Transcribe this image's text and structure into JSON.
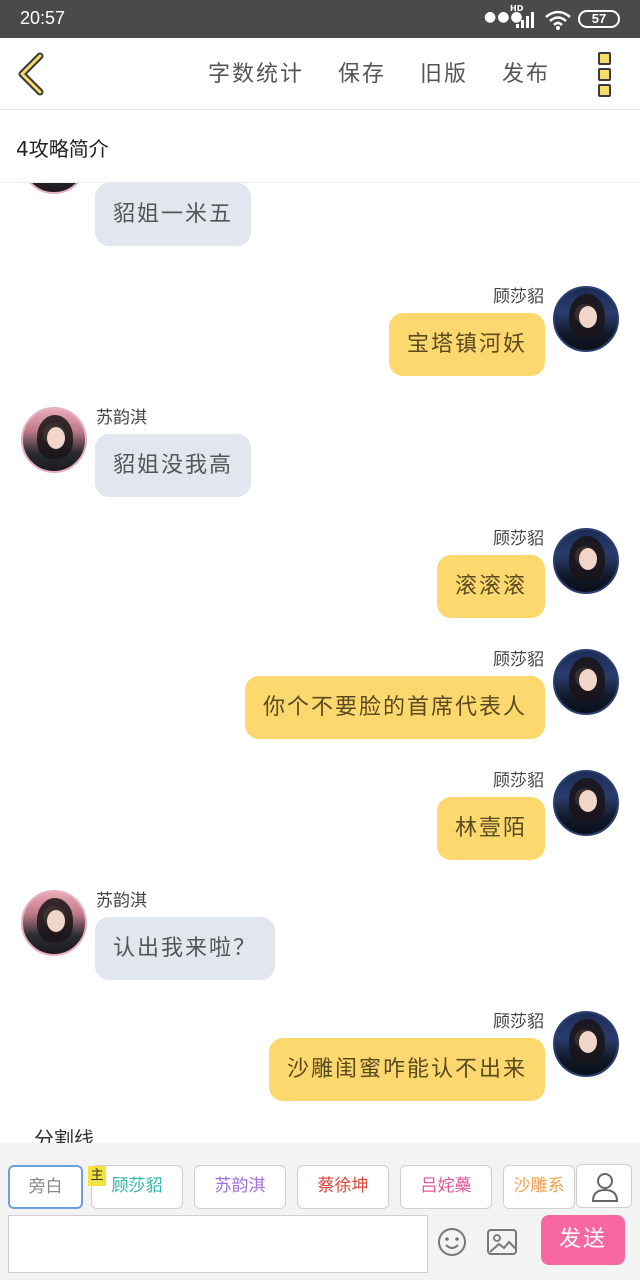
{
  "status_bar": {
    "time": "20:57",
    "battery": "57",
    "network": "HD"
  },
  "toolbar": {
    "word_count": "字数统计",
    "save": "保存",
    "old_version": "旧版",
    "publish": "发布"
  },
  "doc": {
    "title": "4攻略简介"
  },
  "messages": [
    {
      "side": "left",
      "name": "",
      "text": "貂姐一米五"
    },
    {
      "side": "right",
      "name": "顾莎貂",
      "text": "宝塔镇河妖"
    },
    {
      "side": "left",
      "name": "苏韵淇",
      "text": "貂姐没我高"
    },
    {
      "side": "right",
      "name": "顾莎貂",
      "text": "滚滚滚"
    },
    {
      "side": "right",
      "name": "顾莎貂",
      "text": "你个不要脸的首席代表人"
    },
    {
      "side": "right",
      "name": "顾莎貂",
      "text": "林壹陌"
    },
    {
      "side": "left",
      "name": "苏韵淇",
      "text": "认出我来啦？"
    },
    {
      "side": "right",
      "name": "顾莎貂",
      "text": "沙雕闺蜜咋能认不出来"
    }
  ],
  "divider": "分割线",
  "roles": [
    {
      "label": "旁白",
      "color": "#888888"
    },
    {
      "label": "顾莎貂",
      "color": "#2bb8a8"
    },
    {
      "label": "苏韵淇",
      "color": "#a070d8"
    },
    {
      "label": "蔡徐坤",
      "color": "#e0453a"
    },
    {
      "label": "吕姹蘽",
      "color": "#e05a9a"
    },
    {
      "label": "沙雕系",
      "color": "#f0a050"
    }
  ],
  "main_role_tag": "主",
  "input": {
    "value": "",
    "placeholder": ""
  },
  "send": "发送",
  "colors": {
    "accent": "#f767a2",
    "self_bubble": "#fcd86f",
    "other_bubble": "#e2e7ef"
  }
}
